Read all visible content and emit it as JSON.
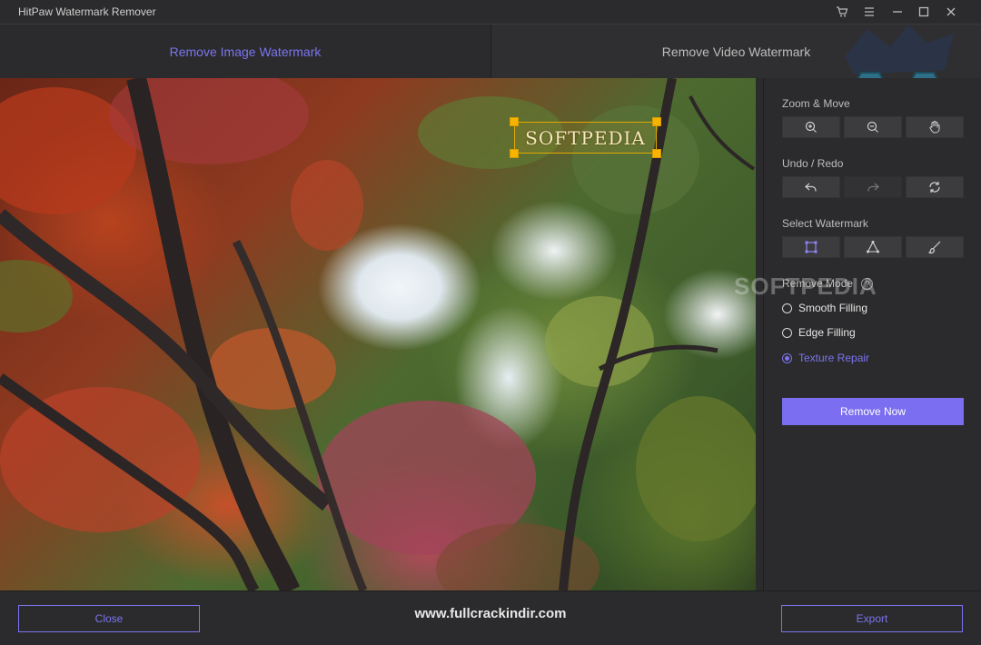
{
  "window": {
    "title": "HitPaw Watermark Remover",
    "controls": [
      "cart-icon",
      "menu-icon",
      "minimize-icon",
      "maximize-icon",
      "close-icon"
    ]
  },
  "tabs": [
    {
      "label": "Remove Image Watermark",
      "active": true
    },
    {
      "label": "Remove Video Watermark",
      "active": false
    }
  ],
  "canvas": {
    "watermark_text": "SOFTPEDIA"
  },
  "panel": {
    "zoom_move": {
      "label": "Zoom & Move",
      "tools": [
        "zoom-in-icon",
        "zoom-out-icon",
        "hand-icon"
      ]
    },
    "undo_redo": {
      "label": "Undo / Redo",
      "tools": [
        "undo-icon",
        "redo-icon",
        "reset-icon"
      ]
    },
    "select_watermark": {
      "label": "Select Watermark",
      "tools": [
        "rectangle-select-icon",
        "polygon-select-icon",
        "brush-icon"
      ]
    },
    "remove_mode": {
      "label": "Remove Mode",
      "help": "?",
      "options": [
        {
          "label": "Smooth Filling",
          "checked": false
        },
        {
          "label": "Edge Filling",
          "checked": false
        },
        {
          "label": "Texture Repair",
          "checked": true
        }
      ]
    },
    "remove_now": "Remove Now",
    "overlay_logo": "SOFTPEDIA"
  },
  "footer": {
    "close": "Close",
    "url": "www.fullcrackindir.com",
    "export": "Export"
  },
  "colors": {
    "accent": "#7b74ee",
    "background": "#2b2b2d",
    "handle": "#f6b300"
  }
}
